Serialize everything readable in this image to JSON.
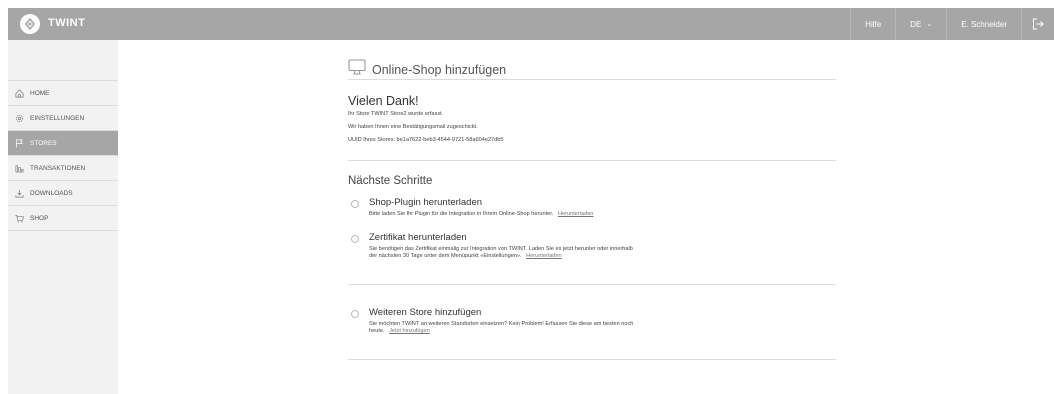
{
  "header": {
    "brand": "TWINT",
    "help": "Hilfe",
    "language": "DE",
    "language_caret": "⌄",
    "user": "E. Schneider"
  },
  "sidebar": {
    "items": [
      {
        "label": "HOME",
        "icon": "home-icon"
      },
      {
        "label": "EINSTELLUNGEN",
        "icon": "gear-icon"
      },
      {
        "label": "STORES",
        "icon": "flag-icon",
        "active": true
      },
      {
        "label": "TRANSAKTIONEN",
        "icon": "bar-chart-icon"
      },
      {
        "label": "DOWNLOADS",
        "icon": "download-icon"
      },
      {
        "label": "SHOP",
        "icon": "cart-icon"
      }
    ]
  },
  "main": {
    "title": "Online-Shop hinzufügen",
    "thanks": {
      "heading": "Vielen Dank!",
      "line1": "Ihr Store TWINT Store2 wurde erfasst.",
      "line2": "Wir haben Ihnen eine Bestätigungsmail zugeschickt.",
      "line3": "UUID Ihres Stores: be1a7622-beb3-4544-9721-58a604e27db5"
    },
    "next_steps": {
      "heading": "Nächste Schritte",
      "steps": [
        {
          "title": "Shop-Plugin herunterladen",
          "text": "Bitte laden Sie Ihr Plugin für die Integration in Ihrem Online-Shop herunter.",
          "link": "Herunterladen"
        },
        {
          "title": "Zertifikat herunterladen",
          "text1": "Sie benötigen das Zertifikat einmalig zur Integration von TWINT. Laden Sie es jetzt herunter oder innerhalb",
          "text2": "der nächsten 30 Tage unter dem Menüpunkt «Einstellungen».",
          "link": "Herunterladen"
        },
        {
          "title": "Weiteren Store hinzufügen",
          "text1": "Sie möchten TWINT an weiteren Standorten einsetzen? Kein Problem! Erfassen Sie diese am besten noch",
          "text2": "heute.",
          "link": "Jetzt hinzufügen"
        }
      ]
    }
  },
  "colors": {
    "topbar": "#a6a6a6",
    "sidebar": "#f2f2f2",
    "active": "#a6a6a6"
  }
}
